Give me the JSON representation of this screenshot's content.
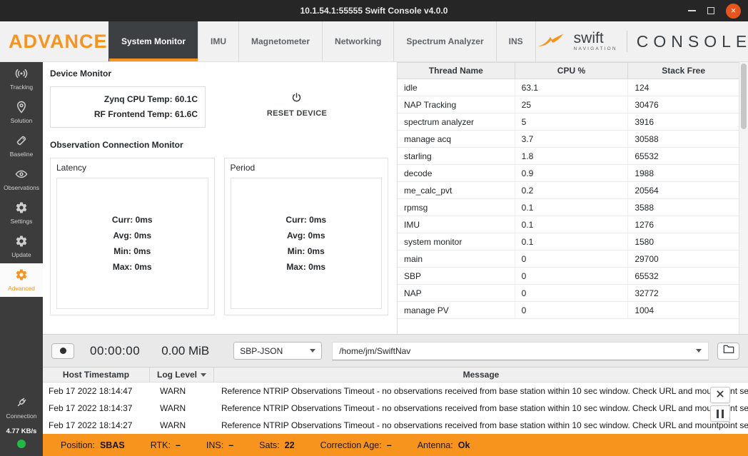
{
  "window": {
    "title": "10.1.54.1:55555 Swift Console v4.0.0"
  },
  "colors": {
    "accent": "#F7941D",
    "status_ok": "#21BA45",
    "tab_active_bg": "#3C4043",
    "sidebar_bg": "#3C3C3C",
    "close_button": "#E9541D"
  },
  "icons": {
    "info": "i",
    "close": "×"
  },
  "header": {
    "advanced_label": "ADVANCED",
    "tabs": [
      {
        "label": "System Monitor",
        "active": true
      },
      {
        "label": "IMU"
      },
      {
        "label": "Magnetometer"
      },
      {
        "label": "Networking"
      },
      {
        "label": "Spectrum Analyzer"
      },
      {
        "label": "INS"
      }
    ],
    "brand": {
      "name": "swift",
      "sub": "NAVIGATION",
      "console": "CONSOLE"
    }
  },
  "sidebar": {
    "items": [
      {
        "label": "Tracking",
        "icon": "tracking-icon"
      },
      {
        "label": "Solution",
        "icon": "solution-icon"
      },
      {
        "label": "Baseline",
        "icon": "baseline-icon"
      },
      {
        "label": "Observations",
        "icon": "observations-icon"
      },
      {
        "label": "Settings",
        "icon": "settings-icon"
      },
      {
        "label": "Update",
        "icon": "update-icon"
      },
      {
        "label": "Advanced",
        "icon": "advanced-icon",
        "active": true
      }
    ],
    "connection": {
      "label": "Connection",
      "icon": "connection-icon",
      "rate": "4.77 KB/s"
    }
  },
  "device_monitor": {
    "title": "Device Monitor",
    "zynq_temp": "Zynq CPU Temp: 60.1C",
    "rf_temp": "RF Frontend Temp: 61.6C",
    "reset_label": "RESET DEVICE"
  },
  "observation_monitor": {
    "title": "Observation Connection Monitor",
    "latency": {
      "title": "Latency",
      "stats": [
        "Curr: 0ms",
        "Avg: 0ms",
        "Min: 0ms",
        "Max: 0ms"
      ]
    },
    "period": {
      "title": "Period",
      "stats": [
        "Curr: 0ms",
        "Avg: 0ms",
        "Min: 0ms",
        "Max: 0ms"
      ]
    }
  },
  "thread_table": {
    "headers": [
      "Thread Name",
      "CPU %",
      "Stack Free"
    ],
    "rows": [
      [
        "idle",
        "63.1",
        "124"
      ],
      [
        "NAP Tracking",
        "25",
        "30476"
      ],
      [
        "spectrum analyzer",
        "5",
        "3916"
      ],
      [
        "manage acq",
        "3.7",
        "30588"
      ],
      [
        "starling",
        "1.8",
        "65532"
      ],
      [
        "decode",
        "0.9",
        "1988"
      ],
      [
        "me_calc_pvt",
        "0.2",
        "20564"
      ],
      [
        "rpmsg",
        "0.1",
        "3588"
      ],
      [
        "IMU",
        "0.1",
        "1276"
      ],
      [
        "system monitor",
        "0.1",
        "1580"
      ],
      [
        "main",
        "0",
        "29700"
      ],
      [
        "SBP",
        "0",
        "65532"
      ],
      [
        "NAP",
        "0",
        "32772"
      ],
      [
        "manage PV",
        "0",
        "1004"
      ]
    ]
  },
  "recording": {
    "time": "00:00:00",
    "size": "0.00 MiB",
    "format": "SBP-JSON",
    "path": "/home/jm/SwiftNav"
  },
  "log": {
    "headers": [
      "Host Timestamp",
      "Log Level",
      "Message"
    ],
    "rows": [
      {
        "timestamp": "Feb 17 2022 18:14:47",
        "level": "WARN",
        "message": "Reference NTRIP Observations Timeout - no observations received from base station within 10 sec window. Check URL and mountpoint settings, or disabl..."
      },
      {
        "timestamp": "Feb 17 2022 18:14:37",
        "level": "WARN",
        "message": "Reference NTRIP Observations Timeout - no observations received from base station within 10 sec window. Check URL and mountpoint settings, or disabl..."
      },
      {
        "timestamp": "Feb 17 2022 18:14:27",
        "level": "WARN",
        "message": "Reference NTRIP Observations Timeout - no observations received from base station within 10 sec window. Check URL and mountpoint settings, or disabl..."
      }
    ]
  },
  "status_bar": {
    "items": [
      {
        "label": "Position:",
        "value": "SBAS"
      },
      {
        "label": "RTK:",
        "value": "–"
      },
      {
        "label": "INS:",
        "value": "–"
      },
      {
        "label": "Sats:",
        "value": "22"
      },
      {
        "label": "Correction Age:",
        "value": "–"
      },
      {
        "label": "Antenna:",
        "value": "Ok"
      }
    ]
  }
}
